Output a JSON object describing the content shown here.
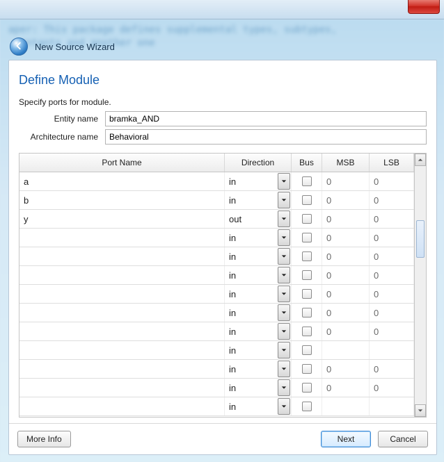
{
  "blurred_code": "aper: This package defines supplemental types, subtypes,\n  entants and another one",
  "wizard": {
    "title": "New Source Wizard"
  },
  "page": {
    "heading": "Define Module",
    "subtext": "Specify ports for module.",
    "entity_label": "Entity name",
    "entity_value": "bramka_AND",
    "arch_label": "Architecture name",
    "arch_value": "Behavioral"
  },
  "table": {
    "columns": {
      "port": "Port Name",
      "direction": "Direction",
      "bus": "Bus",
      "msb": "MSB",
      "lsb": "LSB"
    },
    "rows": [
      {
        "port": "a",
        "direction": "in",
        "bus": false,
        "msb": "0",
        "lsb": "0"
      },
      {
        "port": "b",
        "direction": "in",
        "bus": false,
        "msb": "0",
        "lsb": "0"
      },
      {
        "port": "y",
        "direction": "out",
        "bus": false,
        "msb": "0",
        "lsb": "0"
      },
      {
        "port": "",
        "direction": "in",
        "bus": false,
        "msb": "0",
        "lsb": "0"
      },
      {
        "port": "",
        "direction": "in",
        "bus": false,
        "msb": "0",
        "lsb": "0"
      },
      {
        "port": "",
        "direction": "in",
        "bus": false,
        "msb": "0",
        "lsb": "0"
      },
      {
        "port": "",
        "direction": "in",
        "bus": false,
        "msb": "0",
        "lsb": "0"
      },
      {
        "port": "",
        "direction": "in",
        "bus": false,
        "msb": "0",
        "lsb": "0"
      },
      {
        "port": "",
        "direction": "in",
        "bus": false,
        "msb": "0",
        "lsb": "0"
      },
      {
        "port": "",
        "direction": "in",
        "bus": false,
        "msb": "",
        "lsb": ""
      },
      {
        "port": "",
        "direction": "in",
        "bus": false,
        "msb": "0",
        "lsb": "0"
      },
      {
        "port": "",
        "direction": "in",
        "bus": false,
        "msb": "0",
        "lsb": "0"
      },
      {
        "port": "",
        "direction": "in",
        "bus": false,
        "msb": "",
        "lsb": ""
      }
    ]
  },
  "footer": {
    "more_info": "More Info",
    "next": "Next",
    "cancel": "Cancel"
  }
}
